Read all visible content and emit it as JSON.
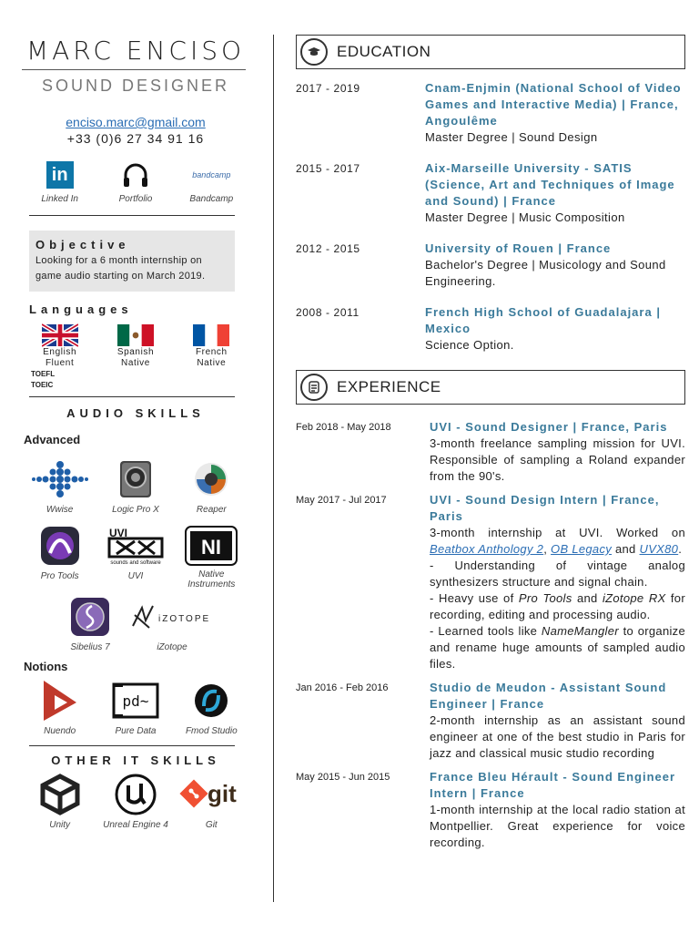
{
  "header": {
    "name": "MARC ENCISO",
    "role": "SOUND DESIGNER",
    "email": "enciso.marc@gmail.com",
    "phone": "+33 (0)6 27 34 91 16"
  },
  "links": [
    {
      "label": "Linked In",
      "icon": "linkedin-icon",
      "glyph": "in"
    },
    {
      "label": "Portfolio",
      "icon": "headphones-icon"
    },
    {
      "label": "Bandcamp",
      "icon": "bandcamp-icon",
      "glyph": "bandcamp"
    }
  ],
  "objective": {
    "title": "Objective",
    "text": "Looking for a 6 month internship on game audio starting on March 2019."
  },
  "languages": {
    "title": "Languages",
    "items": [
      {
        "name": "English",
        "level": "Fluent"
      },
      {
        "name": "Spanish",
        "level": "Native"
      },
      {
        "name": "French",
        "level": "Native"
      }
    ],
    "certs": [
      "TOEFL",
      "TOEIC"
    ]
  },
  "audio_skills": {
    "title": "AUDIO SKILLS",
    "advanced_label": "Advanced",
    "advanced": [
      {
        "name": "Wwise",
        "icon": "wwise-icon"
      },
      {
        "name": "Logic Pro X",
        "icon": "logic-pro-icon"
      },
      {
        "name": "Reaper",
        "icon": "reaper-icon"
      },
      {
        "name": "Pro Tools",
        "icon": "pro-tools-icon"
      },
      {
        "name": "UVI",
        "icon": "uvi-icon",
        "glyph": "UVI",
        "sub": "sounds and software"
      },
      {
        "name": "Native Instruments",
        "icon": "native-instruments-icon",
        "glyph": "NI"
      },
      {
        "name": "Sibelius 7",
        "icon": "sibelius-icon"
      },
      {
        "name": "iZotope",
        "icon": "izotope-icon",
        "glyph": "iZOTOPE"
      }
    ],
    "notions_label": "Notions",
    "notions": [
      {
        "name": "Nuendo",
        "icon": "nuendo-icon"
      },
      {
        "name": "Pure Data",
        "icon": "pure-data-icon",
        "glyph": "pd~"
      },
      {
        "name": "Fmod Studio",
        "icon": "fmod-icon"
      }
    ]
  },
  "it_skills": {
    "title": "OTHER IT SKILLS",
    "items": [
      {
        "name": "Unity",
        "icon": "unity-icon"
      },
      {
        "name": "Unreal Engine 4",
        "icon": "unreal-icon"
      },
      {
        "name": "Git",
        "icon": "git-icon",
        "glyph": "git"
      }
    ]
  },
  "education": {
    "title": "EDUCATION",
    "items": [
      {
        "dates": "2017 - 2019",
        "school": "Cnam-Enjmin (National School of Video Games and Interactive Media) | France, Angoulême",
        "degree": "Master Degree | Sound Design"
      },
      {
        "dates": "2015 - 2017",
        "school": "Aix-Marseille University - SATIS (Science, Art and Techniques of Image and Sound) | France",
        "degree": "Master Degree | Music Composition"
      },
      {
        "dates": "2012 - 2015",
        "school": "University of Rouen | France",
        "degree": "Bachelor's Degree | Musicology and Sound Engineering."
      },
      {
        "dates": "2008 - 2011",
        "school": "French High School of Guadalajara | Mexico",
        "degree": "Science Option."
      }
    ]
  },
  "experience": {
    "title": "EXPERIENCE",
    "e1": {
      "dates": "Feb 2018 - May 2018",
      "title": "UVI - Sound Designer | France, Paris",
      "desc": "3-month freelance sampling mission for UVI. Responsible of sampling a Roland expander from the 90's."
    },
    "e2": {
      "dates": "May 2017 - Jul 2017",
      "title": "UVI - Sound Design Intern | France, Paris",
      "intro": "3-month internship at UVI. Worked on",
      "link1": "Beatbox Anthology 2",
      "sep1": ",",
      "link2": "OB Legacy",
      "and": "and",
      "link3": "UVX80",
      "dot": ".",
      "b1": "- Understanding of vintage analog synthesizers structure and signal chain.",
      "b2a": "- Heavy use of",
      "b2i1": "Pro Tools",
      "b2and": "and",
      "b2i2": "iZotope RX",
      "b2b": "for recording, editing and processing audio.",
      "b3a": "- Learned tools like",
      "b3i": "NameMangler",
      "b3b": "to organize and rename huge amounts of sampled audio files."
    },
    "e3": {
      "dates": "Jan 2016 - Feb 2016",
      "title": "Studio de Meudon - Assistant Sound Engineer | France",
      "desc": "2-month internship as an assistant sound engineer at one of the best studio in Paris for jazz and classical music studio recording"
    },
    "e4": {
      "dates": "May 2015 - Jun 2015",
      "title": "France Bleu Hérault - Sound Engineer Intern | France",
      "desc": "1-month internship at the local radio station at Montpellier. Great experience for voice recording."
    }
  },
  "colors": {
    "accent": "#3a7a9a",
    "link": "#2a6db4",
    "linkedin": "#0e76a8"
  }
}
